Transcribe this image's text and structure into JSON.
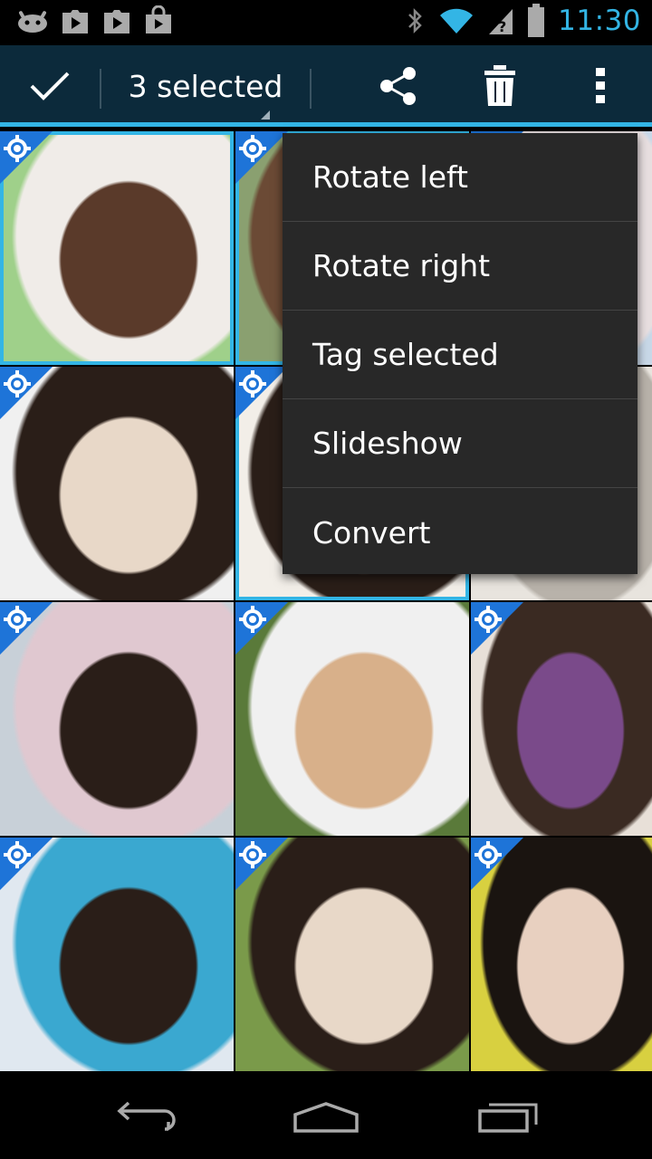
{
  "status_bar": {
    "time": "11:30",
    "left_icons": [
      "android-debug-icon",
      "play-store-icon",
      "play-music-icon",
      "shopping-bag-icon"
    ],
    "right_icons": [
      "bluetooth-icon",
      "wifi-icon",
      "signal-icon",
      "battery-icon"
    ]
  },
  "action_bar": {
    "title": "3 selected",
    "actions": [
      "done-check-icon",
      "share-icon",
      "delete-icon",
      "overflow-menu-icon"
    ]
  },
  "colors": {
    "accent": "#33b5e5",
    "action_bar_bg": "#0c2a3b",
    "badge": "#1e74d8",
    "menu_bg": "#282828"
  },
  "popup_menu": {
    "items": [
      {
        "label": "Rotate left"
      },
      {
        "label": "Rotate right"
      },
      {
        "label": "Tag selected"
      },
      {
        "label": "Slideshow"
      },
      {
        "label": "Convert"
      }
    ]
  },
  "grid": {
    "columns": 3,
    "photos": [
      {
        "name": "photo-1",
        "selected": true,
        "colors": [
          "#9fd08a",
          "#f0ece8",
          "#5a3a2a"
        ]
      },
      {
        "name": "photo-2",
        "selected": true,
        "colors": [
          "#8aa070",
          "#6b4a35",
          "#e8d0c0"
        ]
      },
      {
        "name": "photo-3",
        "selected": false,
        "colors": [
          "#c8d8e8",
          "#e8dfe0",
          "#3a2a22"
        ]
      },
      {
        "name": "photo-4",
        "selected": false,
        "colors": [
          "#f0f0f0",
          "#2a1e18",
          "#e8d8c8"
        ]
      },
      {
        "name": "photo-5",
        "selected": true,
        "colors": [
          "#f2eee8",
          "#2a1e18",
          "#d8c0b0"
        ]
      },
      {
        "name": "photo-6",
        "selected": false,
        "colors": [
          "#e8e4de",
          "#b8b2aa",
          "#dcd0c4"
        ]
      },
      {
        "name": "photo-7",
        "selected": false,
        "colors": [
          "#c8d0d8",
          "#e0c8d0",
          "#2a1e18"
        ]
      },
      {
        "name": "photo-8",
        "selected": false,
        "colors": [
          "#5a7a3a",
          "#f0f0f0",
          "#d8b08a"
        ]
      },
      {
        "name": "photo-9",
        "selected": false,
        "colors": [
          "#e8e0d8",
          "#3a2a22",
          "#7a4a8a"
        ]
      },
      {
        "name": "photo-10",
        "selected": false,
        "colors": [
          "#e0e8f0",
          "#3aa8d0",
          "#2a1e18"
        ]
      },
      {
        "name": "photo-11",
        "selected": false,
        "colors": [
          "#7a9a4a",
          "#2a1e18",
          "#e8d8c8"
        ]
      },
      {
        "name": "photo-12",
        "selected": false,
        "colors": [
          "#d8d040",
          "#1a1410",
          "#e8d0c0"
        ]
      }
    ]
  },
  "nav_bar": {
    "buttons": [
      "back-icon",
      "home-icon",
      "recent-apps-icon"
    ]
  }
}
